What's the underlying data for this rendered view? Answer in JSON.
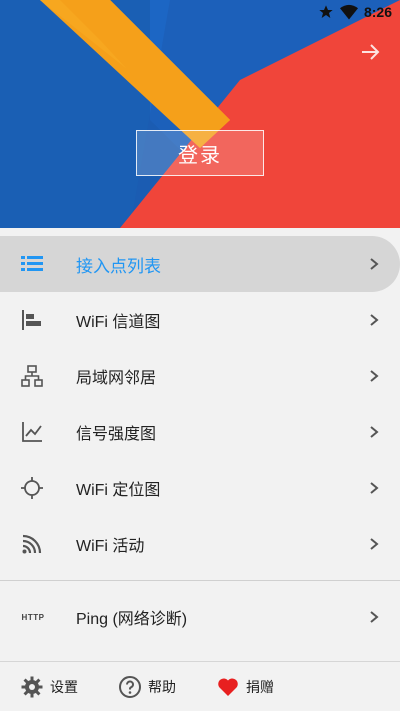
{
  "status_bar": {
    "time": "8:26"
  },
  "header": {
    "login_label": "登录"
  },
  "menu": {
    "items": [
      {
        "label": "接入点列表",
        "icon": "list-icon"
      },
      {
        "label": "WiFi 信道图",
        "icon": "channel-chart-icon"
      },
      {
        "label": "局域网邻居",
        "icon": "lan-icon"
      },
      {
        "label": "信号强度图",
        "icon": "signal-graph-icon"
      },
      {
        "label": "WiFi 定位图",
        "icon": "locate-icon"
      },
      {
        "label": "WiFi 活动",
        "icon": "wifi-activity-icon"
      }
    ],
    "ping": {
      "label": "Ping (网络诊断)",
      "icon_text": "HTTP"
    }
  },
  "footer": {
    "settings_label": "设置",
    "help_label": "帮助",
    "donate_label": "捐赠"
  },
  "colors": {
    "accent": "#2196f3",
    "orange": "#f5a01a",
    "red": "#f0453a",
    "blue": "#1a5fb4"
  }
}
